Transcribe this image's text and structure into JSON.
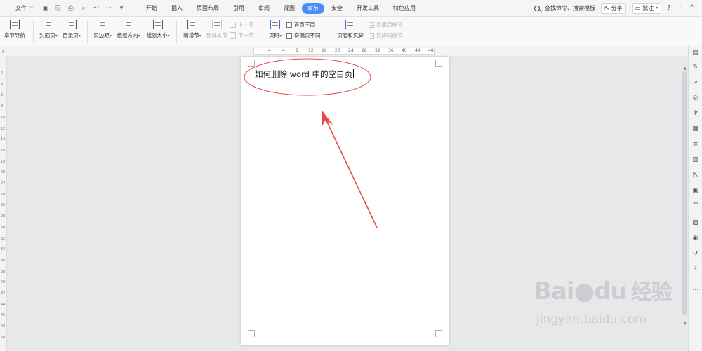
{
  "menubar": {
    "file_label": "文件",
    "tabs": [
      {
        "label": "开始"
      },
      {
        "label": "插入"
      },
      {
        "label": "页面布局"
      },
      {
        "label": "引用"
      },
      {
        "label": "审阅"
      },
      {
        "label": "视图"
      },
      {
        "label": "章节",
        "active": true
      },
      {
        "label": "安全"
      },
      {
        "label": "开发工具"
      },
      {
        "label": "特色应用"
      }
    ],
    "search_label": "查找命令、搜索模板",
    "share_label": "分享",
    "comment_label": "批注",
    "help_icon": "?",
    "more_icon": "⋮",
    "collapse_icon": "^"
  },
  "ribbon": {
    "chapter_nav": "章节导航",
    "cover_page": "封面页",
    "toc_page": "目录页",
    "margins": "页边距",
    "orientation": "纸张方向",
    "paper_size": "纸张大小",
    "new_section": "新增节",
    "delete_section": "删除本节",
    "prev_section": "上一节",
    "next_section": "下一节",
    "page_number": "页码",
    "first_page_diff": "首页不同",
    "odd_even_diff": "奇偶页不同",
    "header_footer": "页眉和页脚",
    "header_same_prev": "页眉同前节",
    "footer_same_prev": "页脚同前节"
  },
  "ruler": {
    "corner": "L",
    "h_ticks": [
      "4",
      "4",
      "8",
      "12",
      "16",
      "20",
      "24",
      "28",
      "32",
      "36",
      "40",
      "44",
      "48"
    ],
    "v_ticks": [
      "2",
      "4",
      "6",
      "8",
      "10",
      "12",
      "14",
      "16",
      "18",
      "20",
      "22",
      "24",
      "26",
      "28",
      "30",
      "32",
      "34",
      "36",
      "38",
      "40",
      "42",
      "44",
      "46",
      "48",
      "50"
    ]
  },
  "document": {
    "text": "如何删除 word 中的空白页"
  },
  "annotation": {
    "color": "#e84a4a"
  },
  "watermark": {
    "brand": "Bai",
    "brand_du": "du",
    "brand_cn": "经验",
    "url": "jingyan.baidu.com"
  },
  "colors": {
    "accent": "#4b8df8",
    "annotation": "#e84a4a"
  }
}
